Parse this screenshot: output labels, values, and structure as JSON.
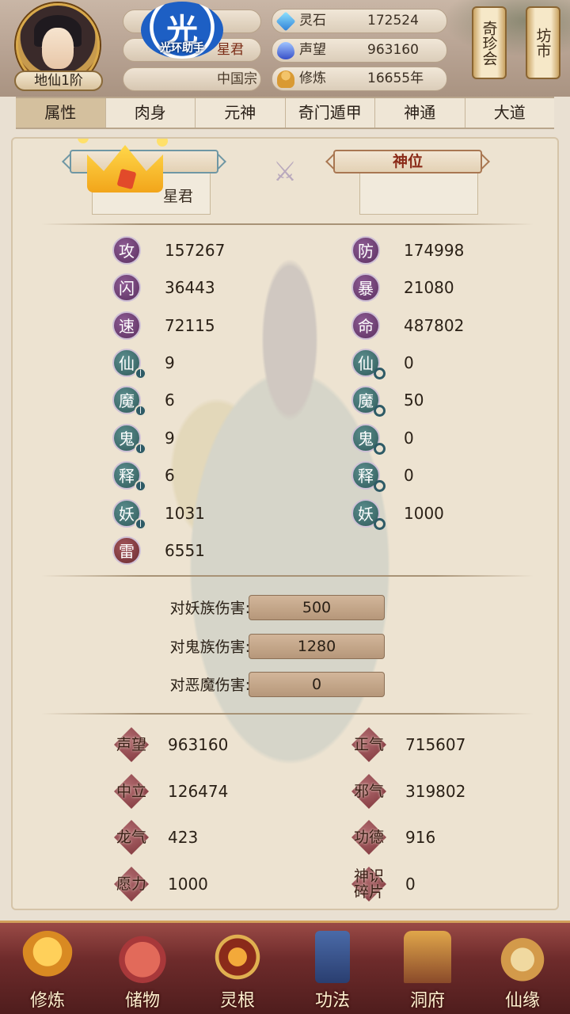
{
  "header": {
    "rank": "地仙1阶",
    "title_partial": "星君",
    "sect_partial": "中国宗",
    "watermark_big": "光",
    "watermark_small": "光环助手",
    "resources": [
      {
        "label": "灵石",
        "value": "172524",
        "icon": "spirit-stone-icon"
      },
      {
        "label": "声望",
        "value": "963160",
        "icon": "fame-icon"
      },
      {
        "label": "修炼",
        "value": "16655年",
        "icon": "cultivation-icon"
      }
    ],
    "scrolls": [
      "奇珍会",
      "坊市"
    ]
  },
  "tabs": [
    "属性",
    "肉身",
    "元神",
    "奇门遁甲",
    "神通",
    "大道"
  ],
  "panel": {
    "left_slot_text": "星君",
    "right_ribbon": "神位",
    "stats_left": [
      {
        "label": "攻",
        "value": "157267"
      },
      {
        "label": "闪",
        "value": "36443"
      },
      {
        "label": "速",
        "value": "72115"
      },
      {
        "label": "仙",
        "value": "9"
      },
      {
        "label": "魔",
        "value": "6"
      },
      {
        "label": "鬼",
        "value": "9"
      },
      {
        "label": "释",
        "value": "6"
      },
      {
        "label": "妖",
        "value": "1031"
      },
      {
        "label": "雷",
        "value": "6551"
      }
    ],
    "stats_right": [
      {
        "label": "防",
        "value": "174998"
      },
      {
        "label": "暴",
        "value": "21080"
      },
      {
        "label": "命",
        "value": "487802"
      },
      {
        "label": "仙",
        "value": "0"
      },
      {
        "label": "魔",
        "value": "50"
      },
      {
        "label": "鬼",
        "value": "0"
      },
      {
        "label": "释",
        "value": "0"
      },
      {
        "label": "妖",
        "value": "1000"
      }
    ],
    "damage": [
      {
        "label": "对妖族伤害:",
        "value": "500"
      },
      {
        "label": "对鬼族伤害:",
        "value": "1280"
      },
      {
        "label": "对恶魔伤害:",
        "value": "0"
      }
    ],
    "reputation_left": [
      {
        "label": "声望",
        "value": "963160"
      },
      {
        "label": "中立",
        "value": "126474"
      },
      {
        "label": "龙气",
        "value": "423"
      },
      {
        "label": "愿力",
        "value": "1000"
      }
    ],
    "reputation_right": [
      {
        "label": "正气",
        "value": "715607"
      },
      {
        "label": "邪气",
        "value": "319802"
      },
      {
        "label": "功德",
        "value": "916"
      },
      {
        "label": "神识碎片",
        "value": "0"
      }
    ]
  },
  "nav": [
    "修炼",
    "储物",
    "灵根",
    "功法",
    "洞府",
    "仙缘"
  ]
}
